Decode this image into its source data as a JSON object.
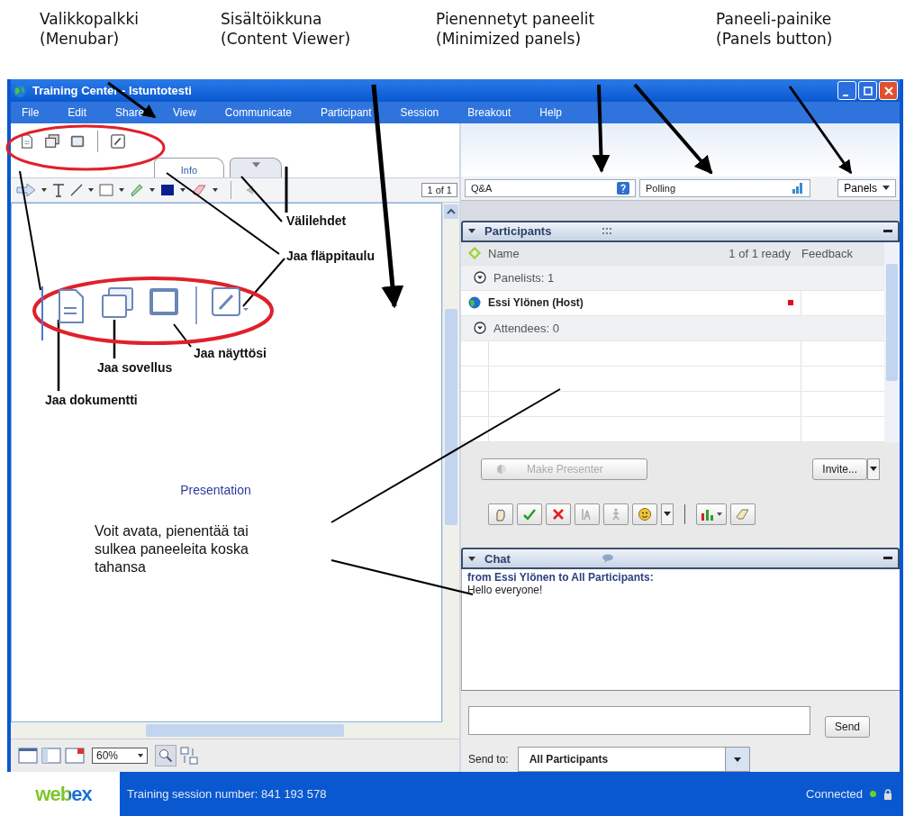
{
  "annotations": {
    "top": [
      {
        "line1": "Valikkopalkki",
        "line2": "(Menubar)"
      },
      {
        "line1": "Sisältöikkuna",
        "line2": "(Content Viewer)"
      },
      {
        "line1": "Pienennetyt paneelit",
        "line2": "(Minimized panels)"
      },
      {
        "line1": "Paneeli-painike",
        "line2": "(Panels button)"
      }
    ],
    "callouts": [
      {
        "text": "Välilehdet",
        "kind": "bold"
      },
      {
        "text": "Jaa fläppitaulu",
        "kind": "bold"
      },
      {
        "text": "Jaa näyttösi",
        "kind": "bold"
      },
      {
        "text": "Jaa sovellus",
        "kind": "bold"
      },
      {
        "text": "Jaa dokumentti",
        "kind": "bold"
      },
      {
        "text": "Voit avata, pienentää tai sulkea paneeleita koska tahansa",
        "kind": "plain"
      }
    ]
  },
  "window": {
    "title": "Training Center - Istuntotesti"
  },
  "menubar": [
    "File",
    "Edit",
    "Share",
    "View",
    "Communicate",
    "Participant",
    "Session",
    "Breakout",
    "Help"
  ],
  "tabs": [
    {
      "kind": "label",
      "label": "Info",
      "selected": true
    },
    {
      "kind": "menu",
      "selected": false
    }
  ],
  "annotation_toolbar": {
    "page": "1 of 1"
  },
  "content": {
    "text": "Presentation"
  },
  "zoom": "60%",
  "panels_bar": {
    "minimized": [
      {
        "kind": "qa",
        "label": "Q&A"
      },
      {
        "kind": "polling",
        "label": "Polling"
      }
    ],
    "button": "Panels"
  },
  "participants": {
    "title": "Participants",
    "columns": [
      "Name",
      "1 of 1 ready",
      "Feedback"
    ],
    "rows": [
      {
        "kind": "group",
        "label": "Panelists: 1",
        "expanded": true
      },
      {
        "kind": "person",
        "label": "Essi Ylönen (Host)"
      },
      {
        "kind": "group",
        "label": "Attendees: 0",
        "expanded": true
      }
    ],
    "make_presenter": {
      "label": "Make Presenter",
      "disabled": true
    },
    "invite": "Invite..."
  },
  "chat": {
    "title": "Chat",
    "messages": [
      {
        "from": "from Essi Ylönen to All Participants:",
        "text": "Hello everyone!"
      }
    ],
    "send": "Send",
    "send_to_label": "Send to:",
    "send_to": "All Participants"
  },
  "status_bar": {
    "logo": "webex",
    "session": "Training session number: 841 193 578",
    "connection": "Connected",
    "connected": true
  }
}
